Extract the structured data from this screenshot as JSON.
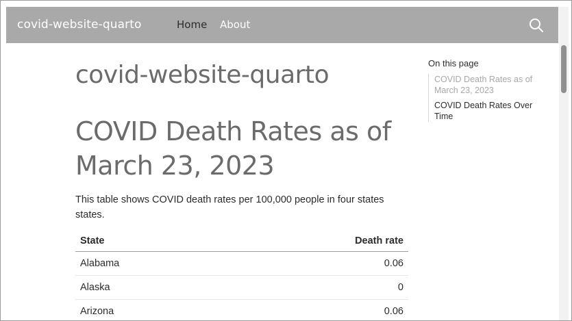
{
  "navbar": {
    "brand": "covid-website-quarto",
    "links": [
      "Home",
      "About"
    ],
    "search_icon": "search-icon"
  },
  "main": {
    "site_title": "covid-website-quarto",
    "section_title": "COVID Death Rates as of March 23, 2023",
    "intro": "This table shows COVID death rates per 100,000 people in four states states.",
    "table": {
      "headers": [
        "State",
        "Death rate"
      ],
      "rows": [
        [
          "Alabama",
          "0.06"
        ],
        [
          "Alaska",
          "0"
        ],
        [
          "Arizona",
          "0.06"
        ]
      ]
    }
  },
  "toc": {
    "title": "On this page",
    "items": [
      "COVID Death Rates as of March 23, 2023",
      "COVID Death Rates Over Time"
    ]
  }
}
